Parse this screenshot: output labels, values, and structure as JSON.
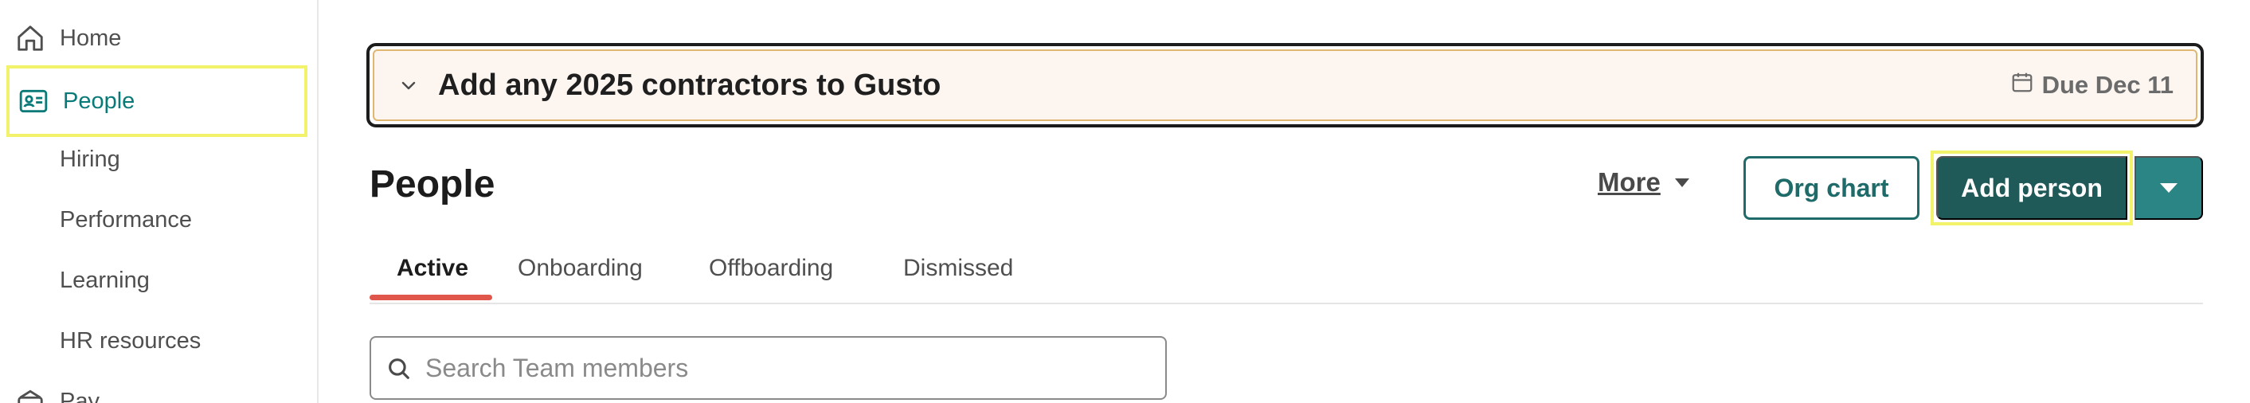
{
  "sidebar": {
    "items": [
      {
        "label": "Home",
        "icon": "home-icon"
      },
      {
        "label": "People",
        "icon": "id-card-icon",
        "active": true
      },
      {
        "label": "Hiring"
      },
      {
        "label": "Performance"
      },
      {
        "label": "Learning"
      },
      {
        "label": "HR resources"
      },
      {
        "label": "Pay",
        "icon": "wallet-icon"
      }
    ]
  },
  "banner": {
    "title": "Add any 2025 contractors to Gusto",
    "due": "Due Dec 11",
    "icon": "calendar-icon"
  },
  "header": {
    "title": "People",
    "more_label": "More",
    "org_chart_label": "Org chart",
    "add_person_label": "Add person"
  },
  "tabs": [
    {
      "label": "Active",
      "active": true
    },
    {
      "label": "Onboarding"
    },
    {
      "label": "Offboarding"
    },
    {
      "label": "Dismissed"
    }
  ],
  "search": {
    "placeholder": "Search Team members",
    "value": ""
  },
  "colors": {
    "accent": "#0a7a78",
    "primary_button": "#1f5a59",
    "dropdown_button": "#2b8584",
    "active_tab_underline": "#e0564a",
    "highlight": "#f2f26b",
    "banner_background": "#fdf5ef"
  }
}
